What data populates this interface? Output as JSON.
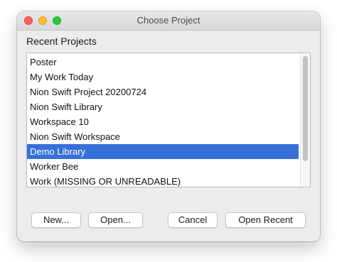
{
  "window": {
    "title": "Choose Project"
  },
  "recent": {
    "label": "Recent Projects",
    "selected_index": 6,
    "items": [
      "Poster",
      "My Work Today",
      "Nion Swift Project 20200724",
      "Nion Swift Library",
      "Workspace 10",
      "Nion Swift Workspace",
      "Demo Library",
      "Worker Bee",
      "Work (MISSING OR UNREADABLE)"
    ]
  },
  "buttons": {
    "new": "New...",
    "open": "Open...",
    "cancel": "Cancel",
    "open_recent": "Open Recent"
  },
  "colors": {
    "selection": "#3670d8",
    "close": "#fe5f57",
    "minimize": "#febc2e",
    "maximize": "#28c840"
  }
}
